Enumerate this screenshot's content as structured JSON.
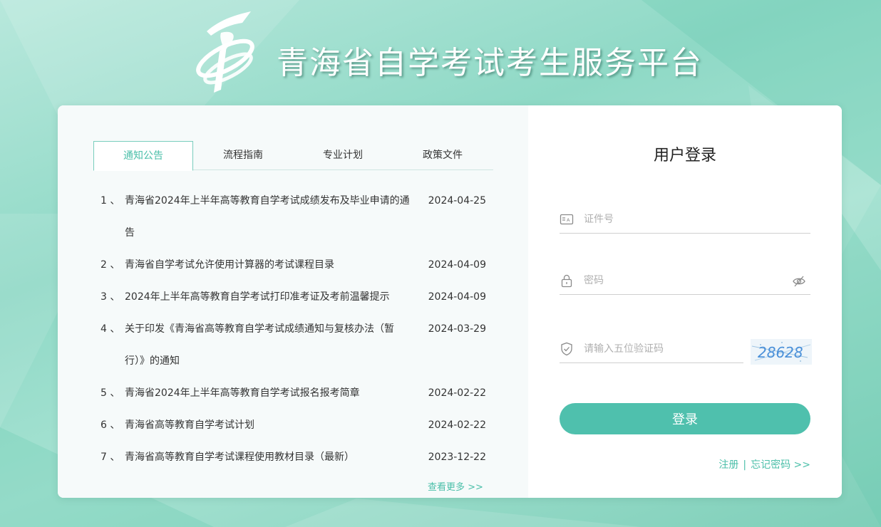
{
  "site": {
    "title": "青海省自学考试考生服务平台"
  },
  "tabs": [
    {
      "label": "通知公告",
      "active": true
    },
    {
      "label": "流程指南",
      "active": false
    },
    {
      "label": "专业计划",
      "active": false
    },
    {
      "label": "政策文件",
      "active": false
    }
  ],
  "notices": [
    {
      "num": "1 、",
      "title": "青海省2024年上半年高等教育自学考试成绩发布及毕业申请的通告",
      "date": "2024-04-25"
    },
    {
      "num": "2 、",
      "title": "青海省自学考试允许使用计算器的考试课程目录",
      "date": "2024-04-09"
    },
    {
      "num": "3 、",
      "title": "2024年上半年高等教育自学考试打印准考证及考前温馨提示",
      "date": "2024-04-09"
    },
    {
      "num": "4 、",
      "title": "关于印发《青海省高等教育自学考试成绩通知与复核办法（暂行）》的通知",
      "date": "2024-03-29"
    },
    {
      "num": "5 、",
      "title": "青海省2024年上半年高等教育自学考试报名报考简章",
      "date": "2024-02-22"
    },
    {
      "num": "6 、",
      "title": "青海省高等教育自学考试计划",
      "date": "2024-02-22"
    },
    {
      "num": "7 、",
      "title": "青海省高等教育自学考试课程使用教材目录（最新）",
      "date": "2023-12-22"
    }
  ],
  "more_label": "查看更多 >>",
  "login": {
    "title": "用户登录",
    "id_placeholder": "证件号",
    "password_placeholder": "密码",
    "captcha_placeholder": "请输入五位验证码",
    "captcha_text": "28628",
    "button_label": "登录",
    "register_label": "注册",
    "separator": "|",
    "forgot_label": "忘记密码 >>"
  },
  "colors": {
    "accent": "#4fc0ad",
    "tab_active": "#4bbfa9",
    "background": "#8fd9c6"
  }
}
